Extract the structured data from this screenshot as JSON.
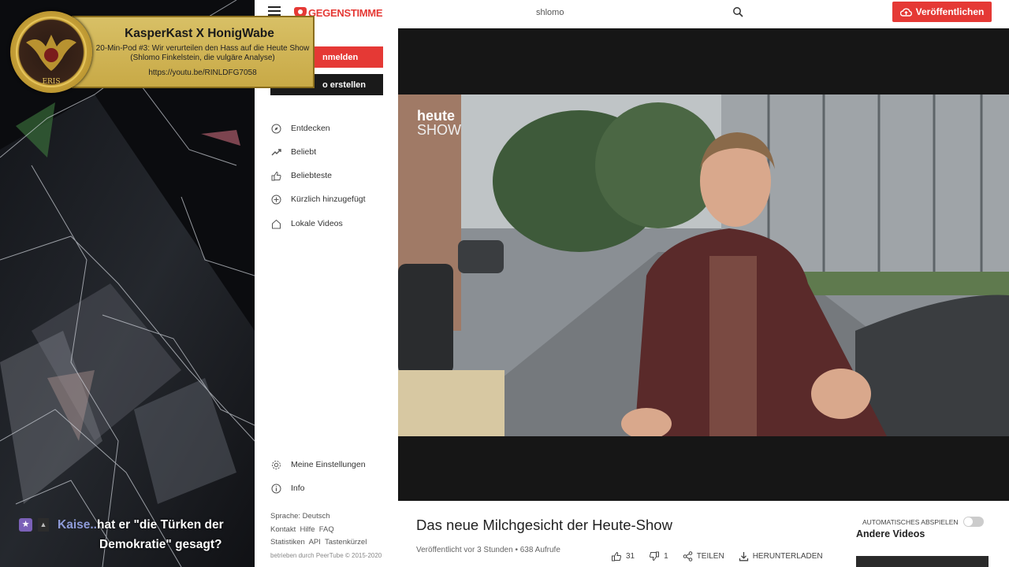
{
  "banner": {
    "title": "KasperKast X HonigWabe",
    "subtitle": "20-Min-Pod #3: Wir verurteilen den Hass auf die Heute Show (Shlomo Finkelstein, die vulgäre Analyse)",
    "url": "https://youtu.be/RINLDFG7058",
    "badge_text": "ERIS"
  },
  "header": {
    "logo_text": "GEGENSTIMME",
    "search_value": "shlomo",
    "publish_label": "Veröffentlichen"
  },
  "sidebar": {
    "login_label": "nmelden",
    "create_label": "o erstellen",
    "items": [
      {
        "label": "Entdecken",
        "icon": "compass-icon"
      },
      {
        "label": "Beliebt",
        "icon": "trending-icon"
      },
      {
        "label": "Beliebteste",
        "icon": "thumbs-up-icon"
      },
      {
        "label": "Kürzlich hinzugefügt",
        "icon": "plus-circle-icon"
      },
      {
        "label": "Lokale Videos",
        "icon": "home-icon"
      }
    ],
    "settings_label": "Meine Einstellungen",
    "info_label": "Info",
    "footer": {
      "language": "Sprache: Deutsch",
      "links1": "Kontakt  Hilfe  FAQ",
      "links2": "Statistiken  API  Tastenkürzel",
      "credit": "betrieben durch PeerTube © 2015-2020"
    }
  },
  "video": {
    "channel_logo_top": "heute",
    "channel_logo_bottom": "SHOW",
    "title": "Das neue Milchgesicht der Heute-Show",
    "meta": "Veröffentlicht vor 3 Stunden • 638 Aufrufe",
    "likes": "31",
    "dislikes": "1",
    "share_label": "TEILEN",
    "download_label": "HERUNTERLADEN"
  },
  "side": {
    "autoplay_label": "AUTOMATISCHES ABSPIELEN",
    "other_videos_label": "Andere Videos"
  },
  "chat": {
    "user": "Kaise...",
    "line1": "hat er \"die Türken der",
    "line2": "Demokratie\" gesagt?"
  }
}
